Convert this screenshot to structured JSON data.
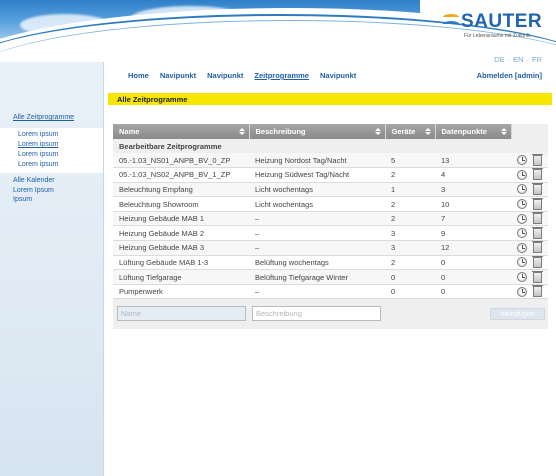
{
  "brand": {
    "name": "SAUTER",
    "tagline": "Für Lebensräume mit Zukunft.",
    "colors": {
      "blue": "#1e64b0",
      "orange": "#f0a81c",
      "highlight": "#f7e600"
    }
  },
  "languages": [
    "DE",
    "EN",
    "FR"
  ],
  "topnav": {
    "items": [
      "Home",
      "Navipunkt",
      "Navipunkt",
      "Zeitprogramme",
      "Navipunkt"
    ],
    "active_index": 3,
    "logout": "Abmelden [admin]"
  },
  "page_title": "Alle Zeitprogramme",
  "sidebar": {
    "main": "Alle Zeitprogramme",
    "sub_items": [
      "Lorem ipsum",
      "Lorem ipsum",
      "Lorem ipsum",
      "Lorem ipsum"
    ],
    "rest_items": [
      "Alle Kalender",
      "Lorem Ipsum",
      "Ipsum"
    ]
  },
  "table": {
    "headers": [
      "Name",
      "Beschreibung",
      "Geräte",
      "Datenpunkte"
    ],
    "group_label": "Bearbeitbare Zeitprogramme",
    "rows": [
      [
        "05.-1.03_NS01_ANPB_BV_0_ZP",
        "Heizung Nordost Tag/Nacht",
        "5",
        "13"
      ],
      [
        "05.-1.03_NS02_ANPB_BV_1_ZP",
        "Heizung Südwest Tag/Nacht",
        "2",
        "4"
      ],
      [
        "Beleuchtung Empfang",
        "Licht wochentags",
        "1",
        "3"
      ],
      [
        "Beleuchtung Showroom",
        "Licht wochentags",
        "2",
        "10"
      ],
      [
        "Heizung Gebäude MAB 1",
        "–",
        "2",
        "7"
      ],
      [
        "Heizung Gebäude MAB 2",
        "–",
        "3",
        "9"
      ],
      [
        "Heizung Gebäude MAB 3",
        "–",
        "3",
        "12"
      ],
      [
        "Lüftung Gebäude MAB 1-3",
        "Belüftung wochentags",
        "2",
        "0"
      ],
      [
        "Lüftung Tiefgarage",
        "Belüftung Tiefgarage Winter",
        "0",
        "0"
      ],
      [
        "Pumpenwerk",
        "–",
        "0",
        "0"
      ]
    ],
    "row_icons": [
      "clock-icon",
      "trash-icon"
    ]
  },
  "add_form": {
    "name_placeholder": "Name",
    "desc_placeholder": "Beschreibung",
    "button": "hinzufügen"
  }
}
